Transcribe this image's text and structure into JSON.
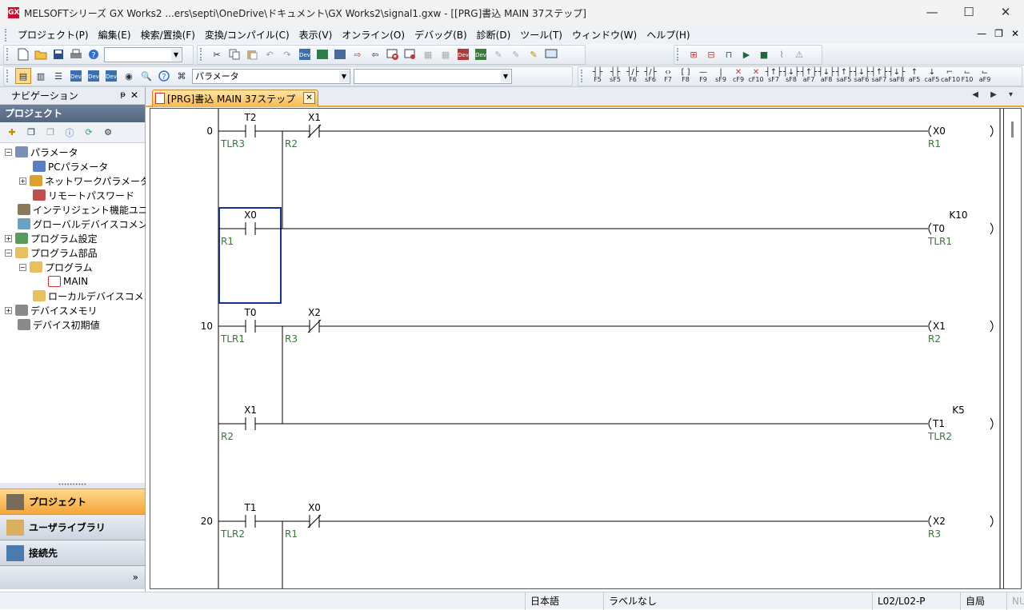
{
  "window": {
    "title": "MELSOFTシリーズ GX Works2 ...ers\\septi\\OneDrive\\ドキュメント\\GX Works2\\signal1.gxw - [[PRG]書込 MAIN 37ステップ]",
    "app_icon_text": "GX",
    "minimize": "—",
    "maximize": "☐",
    "close": "✕"
  },
  "menu": {
    "items": [
      "プロジェクト(P)",
      "編集(E)",
      "検索/置換(F)",
      "変換/コンパイル(C)",
      "表示(V)",
      "オンライン(O)",
      "デバッグ(B)",
      "診断(D)",
      "ツール(T)",
      "ウィンドウ(W)",
      "ヘルプ(H)"
    ],
    "mdi_min": "—",
    "mdi_restore": "❐",
    "mdi_close": "✕"
  },
  "toolbar": {
    "combo1_value": "",
    "param_combo_value": "パラメータ",
    "combo3_value": "",
    "ladder_keys": [
      "F5",
      "sF5",
      "F6",
      "sF6",
      "F7",
      "F8",
      "F9",
      "sF9",
      "cF9",
      "cF10",
      "sF7",
      "sF8",
      "aF7",
      "aF8",
      "saF5",
      "saF6",
      "saF7",
      "saF8",
      "aF5",
      "caF5",
      "caF10",
      "F10",
      "aF9"
    ]
  },
  "navigation": {
    "title": "ナビゲーション",
    "pin": "ᵽ",
    "close": "✕",
    "project_header": "プロジェクト",
    "tree": [
      {
        "label": "パラメータ",
        "level": 0,
        "exp": "−"
      },
      {
        "label": "PCパラメータ",
        "level": 1,
        "exp": ""
      },
      {
        "label": "ネットワークパラメータ",
        "level": 1,
        "exp": "+"
      },
      {
        "label": "リモートパスワード",
        "level": 1,
        "exp": ""
      },
      {
        "label": "インテリジェント機能ユニット",
        "level": 0,
        "exp": ""
      },
      {
        "label": "グローバルデバイスコメント",
        "level": 0,
        "exp": ""
      },
      {
        "label": "プログラム設定",
        "level": 0,
        "exp": "+"
      },
      {
        "label": "プログラム部品",
        "level": 0,
        "exp": "−"
      },
      {
        "label": "プログラム",
        "level": 1,
        "exp": "−"
      },
      {
        "label": "MAIN",
        "level": 2,
        "exp": ""
      },
      {
        "label": "ローカルデバイスコメント",
        "level": 1,
        "exp": ""
      },
      {
        "label": "デバイスメモリ",
        "level": 0,
        "exp": "+"
      },
      {
        "label": "デバイス初期値",
        "level": 0,
        "exp": ""
      }
    ],
    "tabs": [
      "プロジェクト",
      "ユーザライブラリ",
      "接続先"
    ],
    "more": "»"
  },
  "document": {
    "tab_label": "[PRG]書込 MAIN 37ステップ",
    "tab_close": "✕",
    "tab_nav": "◀ ▶ ▾"
  },
  "ladder": {
    "rungs": [
      {
        "step": "0",
        "c1": {
          "dev": "T2",
          "label": "TLR3",
          "type": "no"
        },
        "c2": {
          "dev": "X1",
          "label": "R2",
          "type": "nc"
        },
        "coil": {
          "dev": "X0",
          "label": "R1"
        },
        "k": ""
      },
      {
        "step": "",
        "c1": {
          "dev": "X0",
          "label": "R1",
          "type": "no"
        },
        "c2": null,
        "coil": {
          "dev": "T0",
          "label": "TLR1"
        },
        "k": "K10"
      },
      {
        "step": "10",
        "c1": {
          "dev": "T0",
          "label": "TLR1",
          "type": "no"
        },
        "c2": {
          "dev": "X2",
          "label": "R3",
          "type": "nc"
        },
        "coil": {
          "dev": "X1",
          "label": "R2"
        },
        "k": ""
      },
      {
        "step": "",
        "c1": {
          "dev": "X1",
          "label": "R2",
          "type": "no"
        },
        "c2": null,
        "coil": {
          "dev": "T1",
          "label": "TLR2"
        },
        "k": "K5"
      },
      {
        "step": "20",
        "c1": {
          "dev": "T1",
          "label": "TLR2",
          "type": "no"
        },
        "c2": {
          "dev": "X0",
          "label": "R1",
          "type": "nc"
        },
        "coil": {
          "dev": "X2",
          "label": "R3"
        },
        "k": ""
      }
    ]
  },
  "status": {
    "language": "日本語",
    "label": "ラベルなし",
    "cpu": "L02/L02-P",
    "station": "自局",
    "mode": "NUM"
  },
  "colors": {
    "label_green": "#2e7d32",
    "tab_orange": "#f3a63a",
    "cursor_blue": "#1a2f8a"
  }
}
